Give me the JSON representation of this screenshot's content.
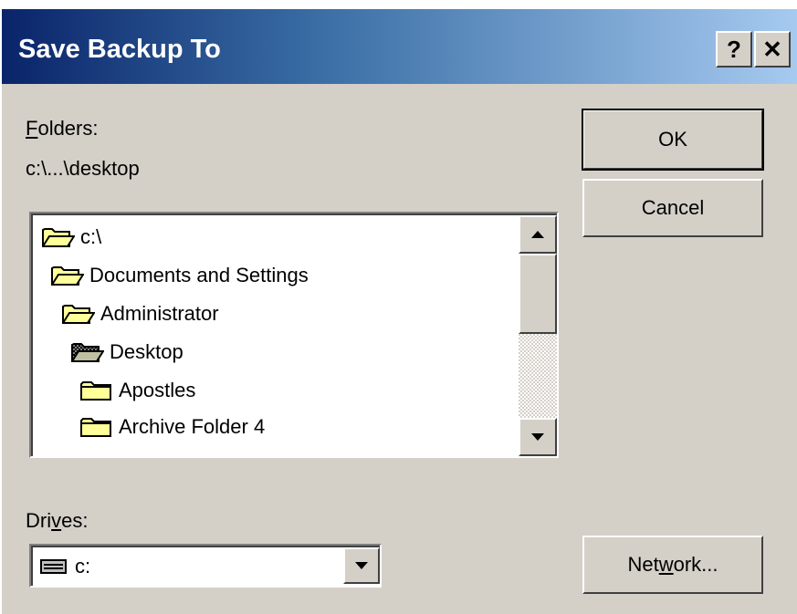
{
  "window": {
    "title": "Save Backup To",
    "help_label": "?",
    "close_label": "✕"
  },
  "folders": {
    "label_mnemonic": "F",
    "label_rest": "olders:",
    "current_path": "c:\\...\\desktop",
    "items": [
      {
        "label": "c:\\",
        "icon": "open-folder-icon"
      },
      {
        "label": "Documents and Settings",
        "icon": "open-folder-icon"
      },
      {
        "label": "Administrator",
        "icon": "open-folder-icon"
      },
      {
        "label": "Desktop",
        "icon": "open-folder-selected-icon"
      },
      {
        "label": "Apostles",
        "icon": "closed-folder-icon"
      },
      {
        "label": "Archive Folder 4",
        "icon": "closed-folder-icon"
      }
    ]
  },
  "drives": {
    "label_pre": "Dri",
    "label_mnemonic": "v",
    "label_post": "es:",
    "selected": "c:",
    "icon": "drive-icon"
  },
  "buttons": {
    "ok": "OK",
    "cancel": "Cancel",
    "network_pre": "Net",
    "network_mnemonic": "w",
    "network_post": "ork..."
  },
  "colors": {
    "titlebar_start": "#0a246a",
    "titlebar_end": "#a6caf0",
    "face": "#d4d0c8",
    "folder_yellow": "#ffff99"
  }
}
